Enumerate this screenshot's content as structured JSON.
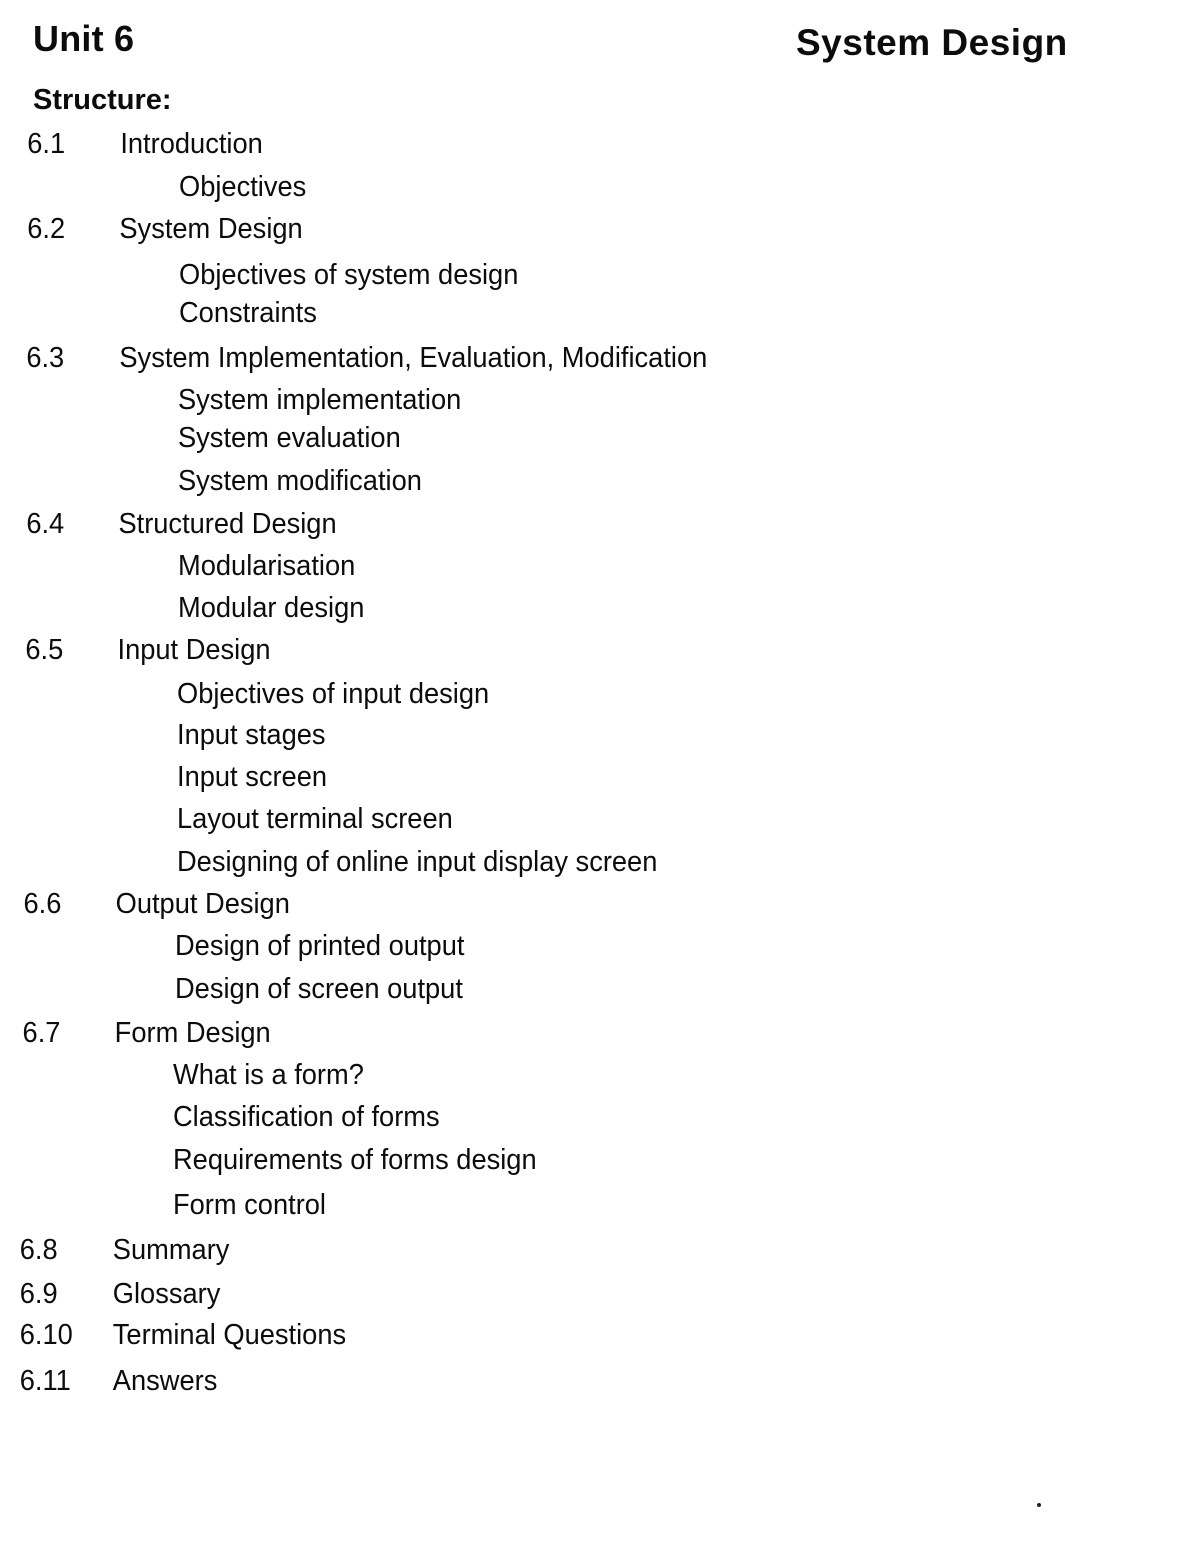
{
  "header": {
    "unit": "Unit 6",
    "chapter_title": "System Design"
  },
  "structure_label": "Structure:",
  "toc": [
    {
      "number": "6.1",
      "title": "Introduction",
      "subsections": [
        "Objectives"
      ]
    },
    {
      "number": "6.2",
      "title": "System Design",
      "subsections": [
        "Objectives of system design",
        "Constraints"
      ]
    },
    {
      "number": "6.3",
      "title": "System Implementation, Evaluation, Modification",
      "subsections": [
        "System implementation",
        "System evaluation",
        "System modification"
      ]
    },
    {
      "number": "6.4",
      "title": "Structured Design",
      "subsections": [
        "Modularisation",
        "Modular design"
      ]
    },
    {
      "number": "6.5",
      "title": "Input Design",
      "subsections": [
        "Objectives of input design",
        "Input stages",
        "Input screen",
        "Layout terminal screen",
        "Designing of online input display screen"
      ]
    },
    {
      "number": "6.6",
      "title": "Output Design",
      "subsections": [
        "Design of printed output",
        "Design of screen output"
      ]
    },
    {
      "number": "6.7",
      "title": "Form Design",
      "subsections": [
        "What is a form?",
        "Classification of forms",
        "Requirements of forms design",
        "Form control"
      ]
    },
    {
      "number": "6.8",
      "title": "Summary",
      "subsections": []
    },
    {
      "number": "6.9",
      "title": "Glossary",
      "subsections": []
    },
    {
      "number": "6.10",
      "title": "Terminal Questions",
      "subsections": []
    },
    {
      "number": "6.11",
      "title": "Answers",
      "subsections": []
    }
  ]
}
